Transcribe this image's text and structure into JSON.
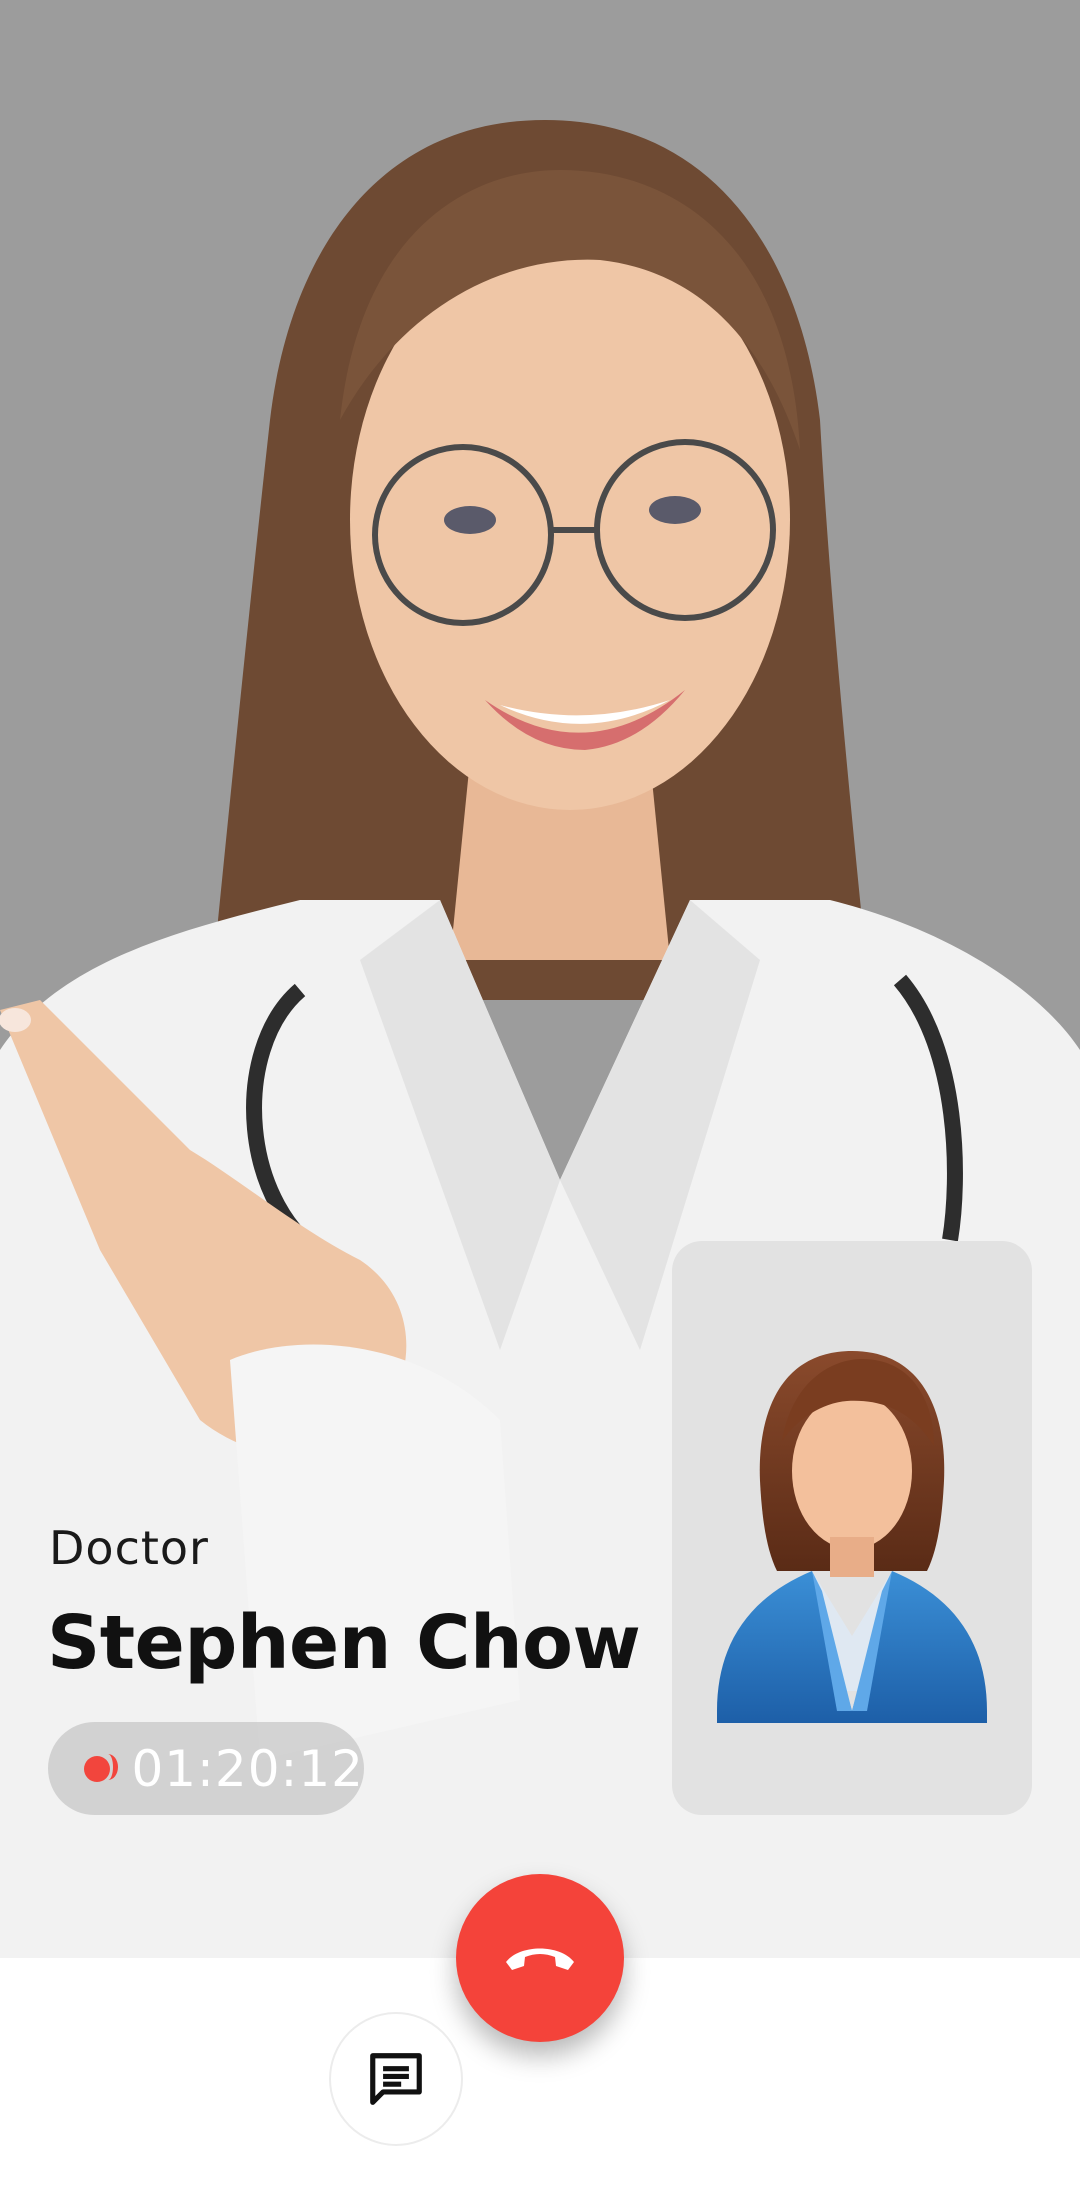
{
  "call": {
    "role": "Doctor",
    "name": "Stephen Chow",
    "duration": "01:20:12",
    "recording": true
  },
  "remote_video": {
    "background": "#9c9c9c",
    "subject": "doctor-portrait"
  },
  "local_preview": {
    "avatar": "female-user-avatar",
    "background": "#e2e2e2"
  },
  "controls": {
    "end_call_icon": "phone-hangup-icon",
    "end_call_color": "#f4433a",
    "chat_icon": "chat-icon"
  },
  "colors": {
    "accent": "#f4433a",
    "recording": "#f2453d"
  }
}
